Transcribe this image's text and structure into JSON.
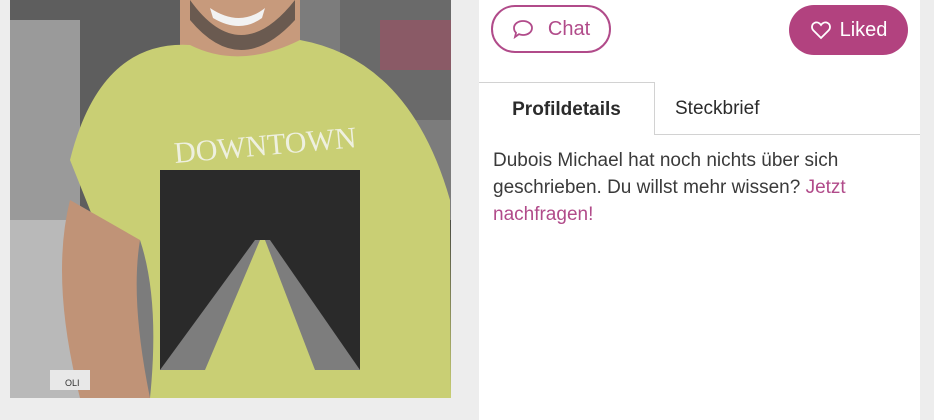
{
  "profile": {
    "shirt_text": "DOWNTOWN",
    "shirt_tag": "OLI"
  },
  "actions": {
    "chat_label": "Chat",
    "chat_icon": "speech-bubble-icon",
    "liked_label": "Liked",
    "liked_icon": "heart-icon",
    "accent_color": "#b14b8a",
    "liked_bg": "#b2427f"
  },
  "tabs": [
    {
      "label": "Profildetails",
      "active": true
    },
    {
      "label": "Steckbrief",
      "active": false
    }
  ],
  "about": {
    "text": "Dubois Michael hat noch nichts über sich geschrieben. Du willst mehr wissen?",
    "link": "Jetzt nachfragen!"
  }
}
